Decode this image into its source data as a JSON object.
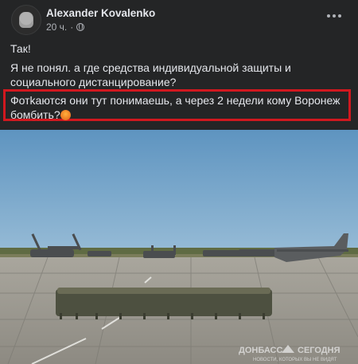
{
  "post": {
    "author": "Alexander Kovalenko",
    "time": "20 ч.",
    "separator": "·",
    "line1": "Так!",
    "line2": "Я не понял. а где средства индивидуальной защиты и социального дистанцирование?",
    "line3": "Фотkаются они тут понимаешь, а через 2 недели кому Воронеж бомбить?",
    "privacy_icon": "globe-icon",
    "menu_icon": "more-options-icon",
    "highlight_color": "#d1181f"
  },
  "photo": {
    "watermark_brand": "ДОНБАСС",
    "watermark_brand2": "СЕГОДНЯ",
    "watermark_tagline": "НОВОСТИ, КОТОРЫХ ВЫ НЕ ВИДЯТ"
  }
}
